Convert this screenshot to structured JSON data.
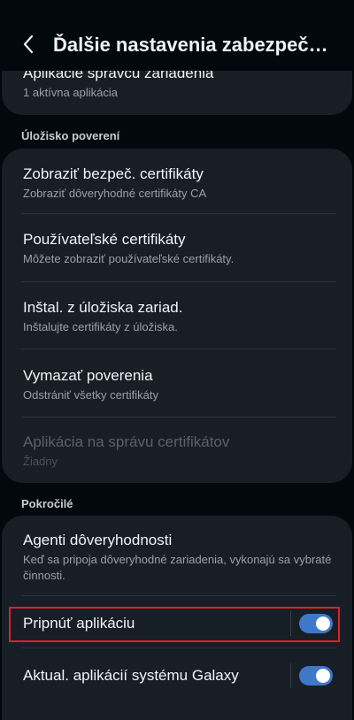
{
  "header": {
    "title": "Ďalšie nastavenia zabezpečenia"
  },
  "colors": {
    "background": "#01090f",
    "card": "#181e26",
    "accent_toggle": "#3f78c9",
    "highlight_border": "#e21f26"
  },
  "top_card": {
    "title": "Aplikácie správcu zariadenia",
    "subtitle": "1 aktívna aplikácia"
  },
  "credential_storage": {
    "header": "Úložisko poverení",
    "items": [
      {
        "title": "Zobraziť bezpeč. certifikáty",
        "subtitle": "Zobraziť dôveryhodné certifikáty CA"
      },
      {
        "title": "Používateľské certifikáty",
        "subtitle": "Môžete zobraziť používateľské certifikáty."
      },
      {
        "title": "Inštal. z úložiska zariad.",
        "subtitle": "Inštalujte certifikáty z úložiska."
      },
      {
        "title": "Vymazať poverenia",
        "subtitle": "Odstrániť všetky certifikáty"
      },
      {
        "title": "Aplikácia na správu certifikátov",
        "subtitle": "Žiadny",
        "disabled": true
      }
    ]
  },
  "advanced": {
    "header": "Pokročilé",
    "trust_agents": {
      "title": "Agenti dôveryhodnosti",
      "subtitle": "Keď sa pripoja dôveryhodné zariadenia, vykonajú sa vybraté činnosti."
    },
    "pin_app": {
      "title": "Pripnúť aplikáciu",
      "enabled": true
    },
    "galaxy_updates": {
      "title": "Aktual. aplikácií systému Galaxy",
      "enabled": true
    }
  },
  "icons": {
    "back": "chevron-left-icon"
  }
}
